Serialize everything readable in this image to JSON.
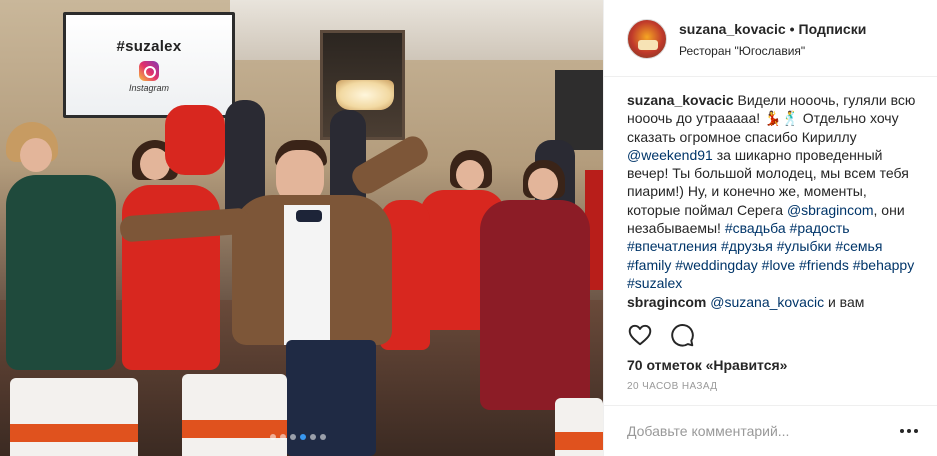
{
  "photo": {
    "screen_hashtag": "#suzalex",
    "screen_brand": "Instagram",
    "carousel_dots": 6,
    "carousel_active_index": 3,
    "icons": [
      "instagram-logo-icon"
    ]
  },
  "header": {
    "username": "suzana_kovacic",
    "separator": "•",
    "follow_label": "Подписки",
    "location": "Ресторан \"Югославия\""
  },
  "caption": {
    "username": "suzana_kovacic",
    "text_1": "Видели нооочь, гуляли всю нооочь до утрааааа!",
    "emoji": "💃🕺",
    "text_2": "Отдельно хочу сказать огромное спасибо Кириллу",
    "mention_1": "@weekend91",
    "text_3": "за шикарно проведенный вечер! Ты большой молодец, мы всем тебя пиарим!) Ну, и конечно же, моменты, которые поймал Серега",
    "mention_2": "@sbragincom",
    "text_4": ", они незабываемы!",
    "hashtags": [
      "#свадьба",
      "#радость",
      "#впечатления",
      "#друзья",
      "#улыбки",
      "#семья",
      "#family",
      "#weddingday",
      "#love",
      "#friends",
      "#behappy",
      "#suzalex"
    ]
  },
  "comment": {
    "username": "sbragincom",
    "mention": "@suzana_kovacic",
    "text": "и вам"
  },
  "actions": {
    "icons": [
      "heart-icon",
      "comment-icon"
    ]
  },
  "likes_label": "70 отметок «Нравится»",
  "time_label": "20 ЧАСОВ НАЗАД",
  "add_comment": {
    "placeholder": "Добавьте комментарий...",
    "icon": "more-options-icon"
  },
  "colors": {
    "link": "#003569",
    "text": "#262626",
    "muted": "#999999",
    "border": "#efefef",
    "carousel_active": "#3897f0"
  }
}
